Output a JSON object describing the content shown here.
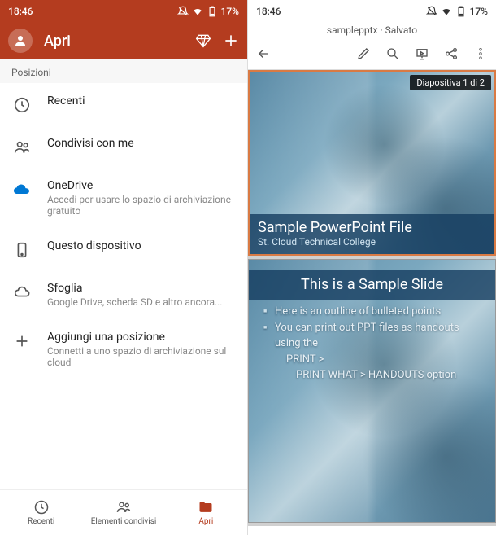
{
  "status": {
    "time": "18:46",
    "battery": "17%"
  },
  "left": {
    "header_title": "Apri",
    "section_label": "Posizioni",
    "items": [
      {
        "title": "Recenti",
        "sub": ""
      },
      {
        "title": "Condivisi con me",
        "sub": ""
      },
      {
        "title": "OneDrive",
        "sub": "Accedi per usare lo spazio di archiviazione gratuito"
      },
      {
        "title": "Questo dispositivo",
        "sub": ""
      },
      {
        "title": "Sfoglia",
        "sub": "Google Drive, scheda SD e altro ancora..."
      },
      {
        "title": "Aggiungi una posizione",
        "sub": "Connetti a uno spazio di archiviazione sul cloud"
      }
    ],
    "bottom": {
      "recents": "Recenti",
      "shared": "Elementi condivisi",
      "open": "Apri"
    }
  },
  "right": {
    "doc_title": "samplepptx · Salvato",
    "slide_counter": "Diapositiva 1 di 2",
    "slide1": {
      "title": "Sample PowerPoint File",
      "subtitle": "St. Cloud Technical College"
    },
    "slide2": {
      "heading": "This is a Sample Slide",
      "b1": "Here is an outline of bulleted points",
      "b2": "You can print out PPT files as handouts using the",
      "b2a": "PRINT >",
      "b2b": "PRINT WHAT > HANDOUTS option"
    }
  }
}
